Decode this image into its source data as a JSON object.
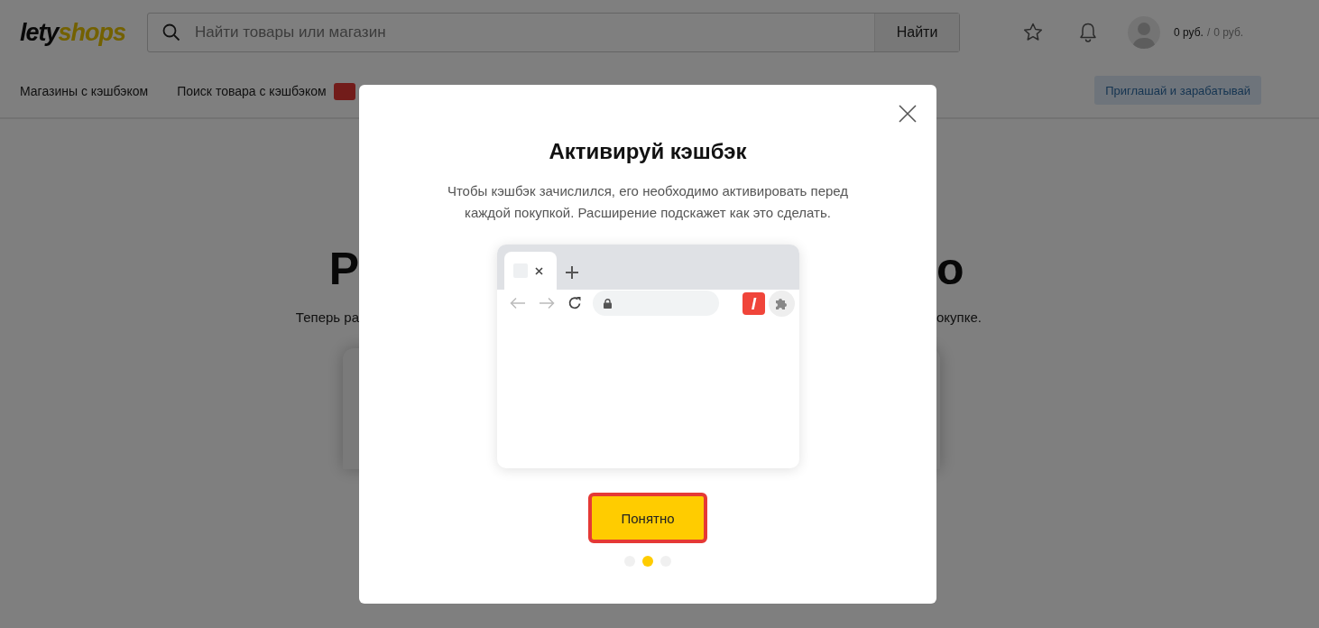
{
  "header": {
    "logo": {
      "part_1": "lety",
      "part_2": "shops"
    },
    "search": {
      "placeholder": "Найти товары или магазин",
      "button": "Найти"
    },
    "balance": {
      "main": "0 руб.",
      "separator": "/",
      "pending": "0 руб."
    }
  },
  "nav": {
    "items": [
      {
        "label": "Магазины с кэшбэком"
      },
      {
        "label": "Поиск товара с кэшбэком",
        "badge": true
      }
    ],
    "invite_button": "Приглашай и зарабатывай"
  },
  "hero": {
    "title_left": "Р",
    "title_right": "о",
    "subtitle_left": "Теперь ра",
    "subtitle_right": "окупке."
  },
  "modal": {
    "title": "Активируй кэшбэк",
    "description": "Чтобы кэшбэк зачислился, его необходимо активировать перед каждой покупкой. Расширение подскажет как это сделать.",
    "extension_label": "l",
    "button": "Понятно",
    "dots": [
      {
        "selected": false
      },
      {
        "selected": true
      },
      {
        "selected": false
      }
    ]
  }
}
